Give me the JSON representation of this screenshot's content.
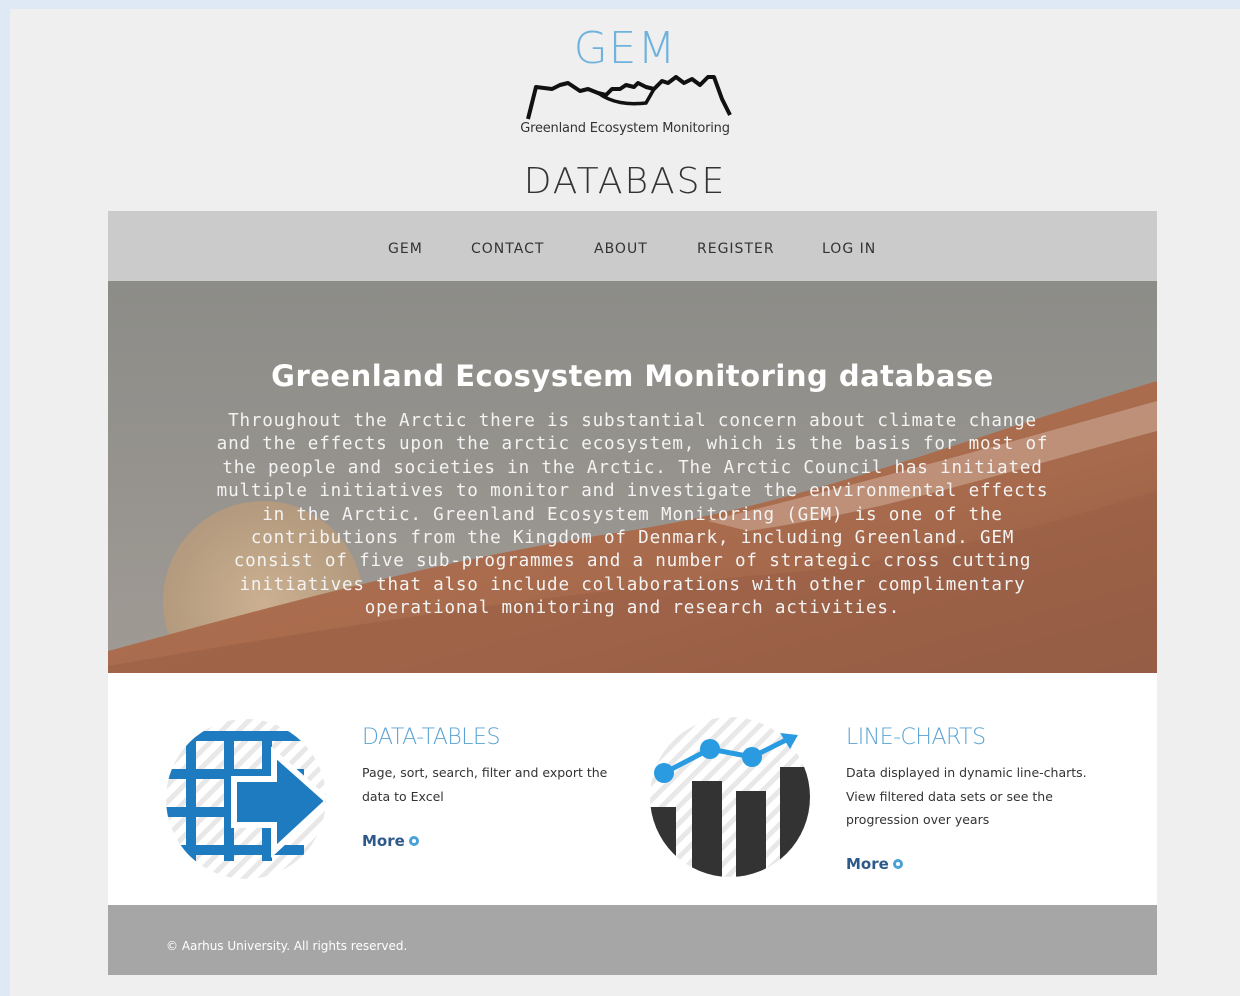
{
  "logo": {
    "name": "GEM",
    "subtitle": "Greenland Ecosystem Monitoring"
  },
  "header": {
    "title": "DATABASE"
  },
  "nav": {
    "items": [
      "GEM",
      "CONTACT",
      "ABOUT",
      "REGISTER",
      "LOG IN"
    ]
  },
  "hero": {
    "title": "Greenland Ecosystem Monitoring database",
    "text": "Throughout the Arctic there is substantial concern about climate change and the effects upon the arctic ecosystem, which is the basis for most of the people and societies in the Arctic. The Arctic Council has initiated multiple initiatives to monitor and investigate the environmental effects in the Arctic. Greenland Ecosystem Monitoring (GEM) is one of the contributions from the Kingdom of Denmark, including Greenland. GEM consist of five sub-programmes and a number of strategic cross cutting initiatives that also include collaborations with other complimentary operational monitoring and research activities."
  },
  "features": [
    {
      "title": "DATA-TABLES",
      "desc_lines": [
        "Page, sort, search, filter and export the",
        "data to Excel"
      ],
      "more": "More",
      "icon": "data-table-export-icon"
    },
    {
      "title": "LINE-CHARTS",
      "desc_lines": [
        "Data displayed in dynamic line-charts.",
        "View filtered data sets or see the",
        "progression over years"
      ],
      "more": "More",
      "icon": "line-chart-icon"
    }
  ],
  "footer": {
    "copyright": "© Aarhus University. All rights reserved."
  },
  "colors": {
    "accent": "#5aa3d4",
    "icon_blue": "#1f7bbf",
    "icon_dark": "#333333",
    "nav_bg": "#cbcbcb",
    "footer_bg": "#a6a6a6"
  }
}
